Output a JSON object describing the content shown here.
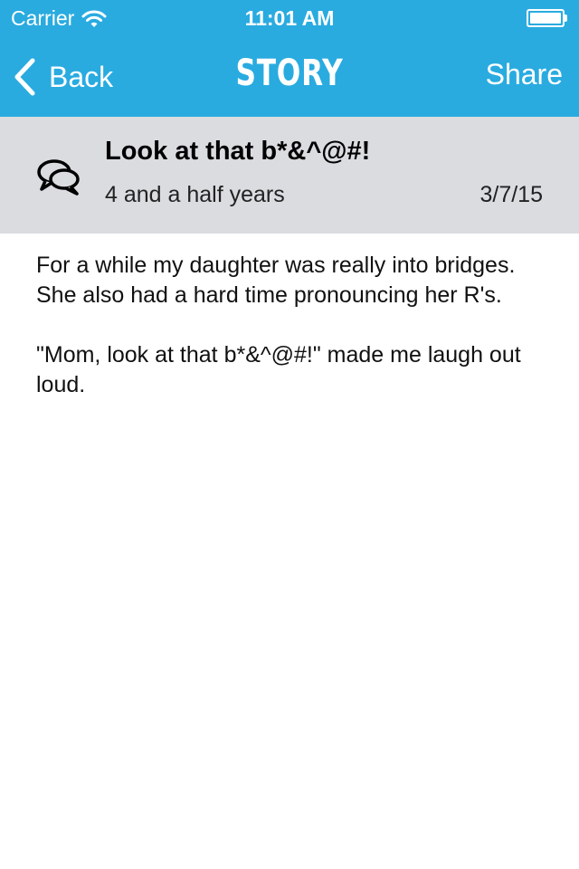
{
  "status_bar": {
    "carrier": "Carrier",
    "time": "11:01 AM",
    "wifi_icon": "wifi-icon",
    "battery_icon": "battery-icon"
  },
  "nav": {
    "back_label": "Back",
    "title": "STORY",
    "share_label": "Share",
    "bar_color": "#29abe0"
  },
  "story": {
    "icon": "chat-bubbles-icon",
    "title": "Look at that b*&^@#!",
    "age": "4 and a half years",
    "date": "3/7/15",
    "paragraphs": [
      "For a while my daughter was really into bridges. She also had a hard time pronouncing her R's.",
      "\"Mom, look at that b*&^@#!\" made me laugh out loud."
    ]
  }
}
